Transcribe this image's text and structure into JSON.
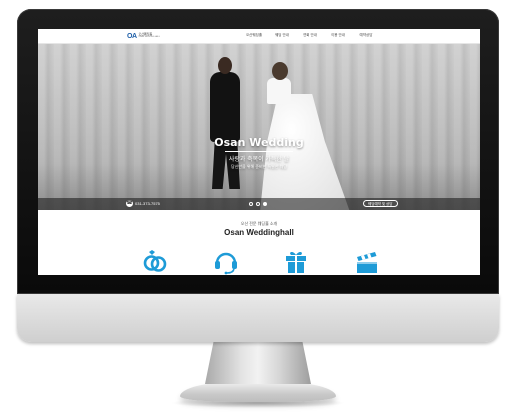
{
  "site": {
    "logo_mark": "OA",
    "logo_name": "오산웨딩홀",
    "logo_sub": "OSAN WEDDING HALL"
  },
  "nav": {
    "items": [
      "오산웨딩홀",
      "웨딩 안내",
      "연회 안내",
      "이용 안내",
      "예약상담"
    ]
  },
  "hero": {
    "title": "Osan Wedding",
    "subtitle": "사랑과 축복이 가득한 날",
    "caption": "당신만을 위해 준비한 특별한 웨딩",
    "phone": "031-373-7575",
    "reserve_button": "웨딩예약 및 상담",
    "slide_count": 3,
    "active_slide": 3
  },
  "intro": {
    "label": "오산 전문 웨딩홀 소개",
    "title": "Osan Weddinghall"
  },
  "features": [
    {
      "icon": "rings-icon"
    },
    {
      "icon": "headset-icon"
    },
    {
      "icon": "gift-icon"
    },
    {
      "icon": "clapperboard-icon"
    }
  ],
  "colors": {
    "accent": "#1e9bd7",
    "logo": "#1e5fa8",
    "bezel": "#111111"
  }
}
